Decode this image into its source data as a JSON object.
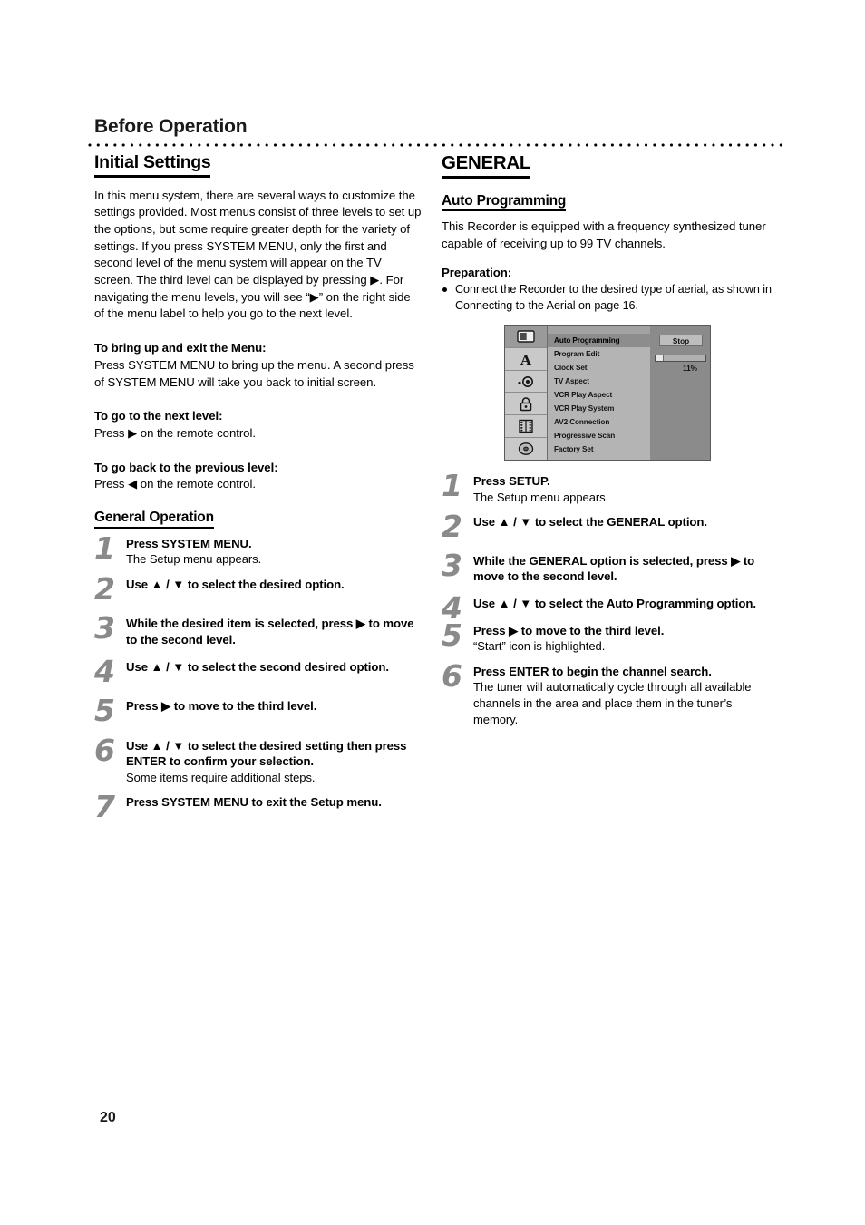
{
  "header": {
    "chapter": "Before Operation"
  },
  "page_number": "20",
  "left_column": {
    "section_title": "Initial Settings",
    "intro_paragraph": "In this menu system, there are several ways to customize the settings provided. Most menus consist of three levels to set up the options, but some require greater depth for the variety of settings. If you press SYSTEM MENU, only the first and second level of the menu system will appear on the TV screen. The third level can be displayed by pressing ▶. For navigating the menu levels, you will see “▶” on the right side of the menu label to help you go to the next level.",
    "blocks": [
      {
        "heading": "To bring up and exit the Menu:",
        "text": "Press SYSTEM MENU to bring up the menu. A second press of SYSTEM MENU will take you back to initial screen."
      },
      {
        "heading": "To go to the next level:",
        "text": "Press ▶ on the remote control."
      },
      {
        "heading": "To go back to the previous level:",
        "text": "Press ◀ on the remote control."
      }
    ],
    "operation_title": "General Operation",
    "steps": [
      {
        "num": "1",
        "main": "Press SYSTEM MENU.",
        "sub": "The Setup menu appears."
      },
      {
        "num": "2",
        "main": "Use ▲ / ▼ to select the desired option.",
        "sub": ""
      },
      {
        "num": "3",
        "main": "While the desired item is selected, press ▶ to move to the second level.",
        "sub": ""
      },
      {
        "num": "4",
        "main": "Use ▲ / ▼ to select the second desired option.",
        "sub": ""
      },
      {
        "num": "5",
        "main": "Press ▶ to move to the third level.",
        "sub": ""
      },
      {
        "num": "6",
        "main": "Use ▲ / ▼ to select the desired setting then press ENTER to confirm your selection.",
        "sub": "Some items require additional steps."
      },
      {
        "num": "7",
        "main": "Press SYSTEM MENU to exit the Setup menu.",
        "sub": ""
      }
    ]
  },
  "right_column": {
    "section_title": "GENERAL",
    "sub_title": "Auto Programming",
    "intro_paragraph": "This Recorder is equipped with a frequency synthesized tuner capable of receiving up to 99 TV channels.",
    "preparation_heading": "Preparation:",
    "preparation_bullet": "Connect the Recorder to the desired type of aerial, as shown in Connecting to the Aerial on page 16.",
    "steps": [
      {
        "num": "1",
        "main": "Press SETUP.",
        "sub": "The Setup menu appears."
      },
      {
        "num": "2",
        "main": "Use ▲ / ▼ to select the GENERAL option.",
        "sub": ""
      },
      {
        "num": "3",
        "main": "While the GENERAL option is selected, press ▶ to move to the second level.",
        "sub": ""
      },
      {
        "num": "4",
        "main": "Use ▲ / ▼ to select the Auto Programming option.",
        "sub": ""
      },
      {
        "num": "5",
        "main": "Press ▶ to move to the third level.",
        "sub": "“Start” icon is highlighted."
      },
      {
        "num": "6",
        "main": "Press ENTER to begin the channel search.",
        "sub": "The tuner will automatically cycle through all available channels in the area and place them in the tuner’s memory."
      }
    ]
  },
  "osd_menu": {
    "sidebar_icons": [
      "tv-monitor-icon",
      "language-letter-a-icon",
      "audio-speaker-icon",
      "lock-icon",
      "film-strip-icon",
      "disc-icon"
    ],
    "menu_items": [
      "Auto Programming",
      "Program Edit",
      "Clock Set",
      "TV Aspect",
      "VCR Play Aspect",
      "VCR Play System",
      "AV2 Connection",
      "Progressive Scan",
      "Factory Set"
    ],
    "selected_item": "Auto Programming",
    "stop_button": "Stop",
    "progress_percent": "11%",
    "progress_value": 11,
    "colors": {
      "panel_bg": "#8b8b8b",
      "list_bg": "#b4b4b4",
      "sidebar_bg": "#c6c6c6",
      "selected_bg": "#8d8d8d"
    }
  }
}
